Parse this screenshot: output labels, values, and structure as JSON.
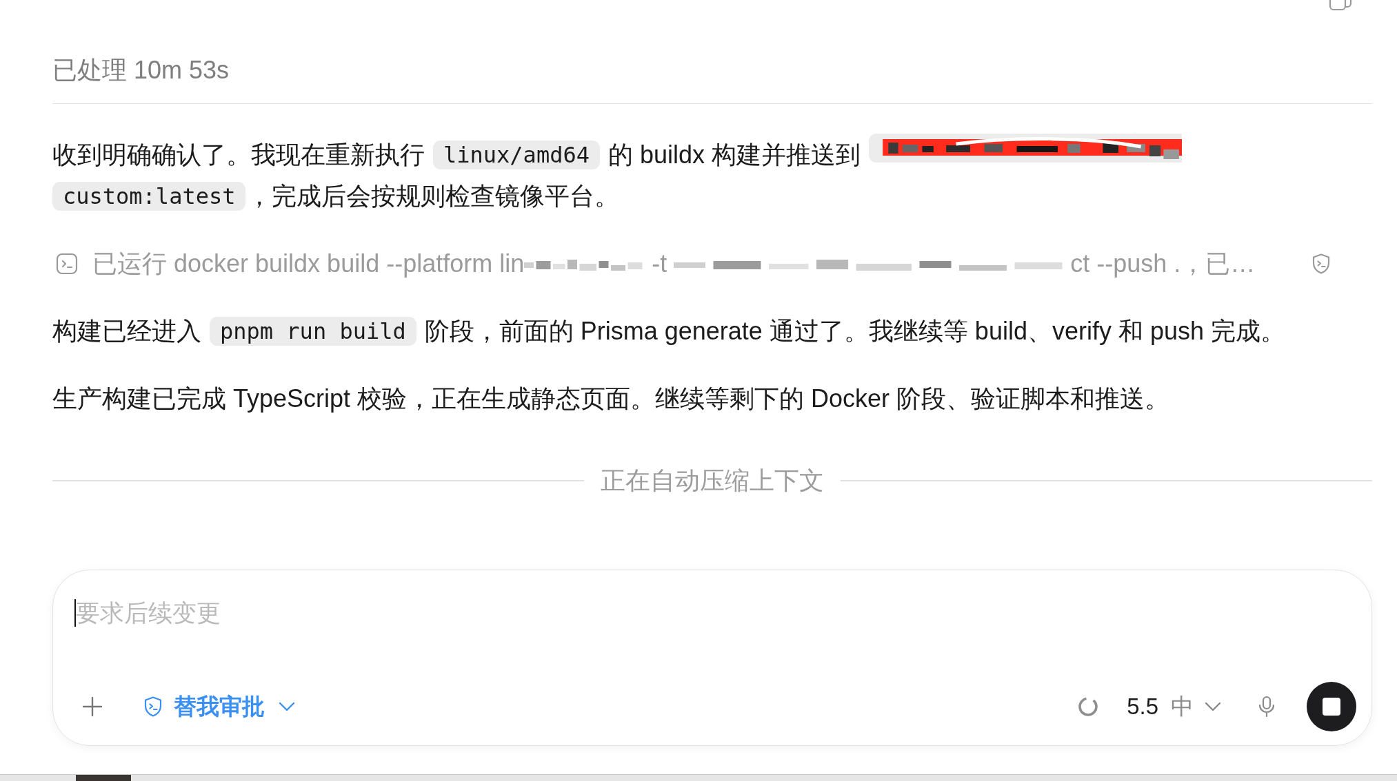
{
  "status_line": {
    "text": "已处理 10m 53s"
  },
  "messages": [
    {
      "kind": "paragraph",
      "segments": [
        {
          "kind": "text",
          "text": "收到明确确认了。我现在重新执行 "
        },
        {
          "kind": "code",
          "text": "linux/amd64"
        },
        {
          "kind": "text",
          "text": " 的 buildx 构建并推送到 "
        },
        {
          "kind": "redacted_code"
        },
        {
          "kind": "code",
          "text": "custom:latest"
        },
        {
          "kind": "text",
          "text": "，完成后会按规则检查镜像平台。"
        }
      ]
    },
    {
      "kind": "command",
      "segments": [
        {
          "kind": "text",
          "text": "已运行 docker buildx build --platform lin"
        },
        {
          "kind": "blurred"
        },
        {
          "kind": "text",
          "text": " -t "
        },
        {
          "kind": "blurred"
        },
        {
          "kind": "text",
          "text": "ct --push .，已…"
        }
      ]
    },
    {
      "kind": "paragraph",
      "segments": [
        {
          "kind": "text",
          "text": "构建已经进入 "
        },
        {
          "kind": "code",
          "text": "pnpm run build"
        },
        {
          "kind": "text",
          "text": " 阶段，前面的 Prisma generate 通过了。我继续等 build、verify 和 push 完成。"
        }
      ]
    },
    {
      "kind": "paragraph",
      "segments": [
        {
          "kind": "text",
          "text": "生产构建已完成 TypeScript 校验，正在生成静态页面。继续等剩下的 Docker 阶段、验证脚本和推送。"
        }
      ]
    }
  ],
  "context_notice": {
    "text": "正在自动压缩上下文"
  },
  "composer": {
    "placeholder": "要求后续变更",
    "focused": true,
    "approval": {
      "label": "替我审批"
    },
    "model": {
      "version": "5.5",
      "effort": "中"
    },
    "generating": true
  }
}
